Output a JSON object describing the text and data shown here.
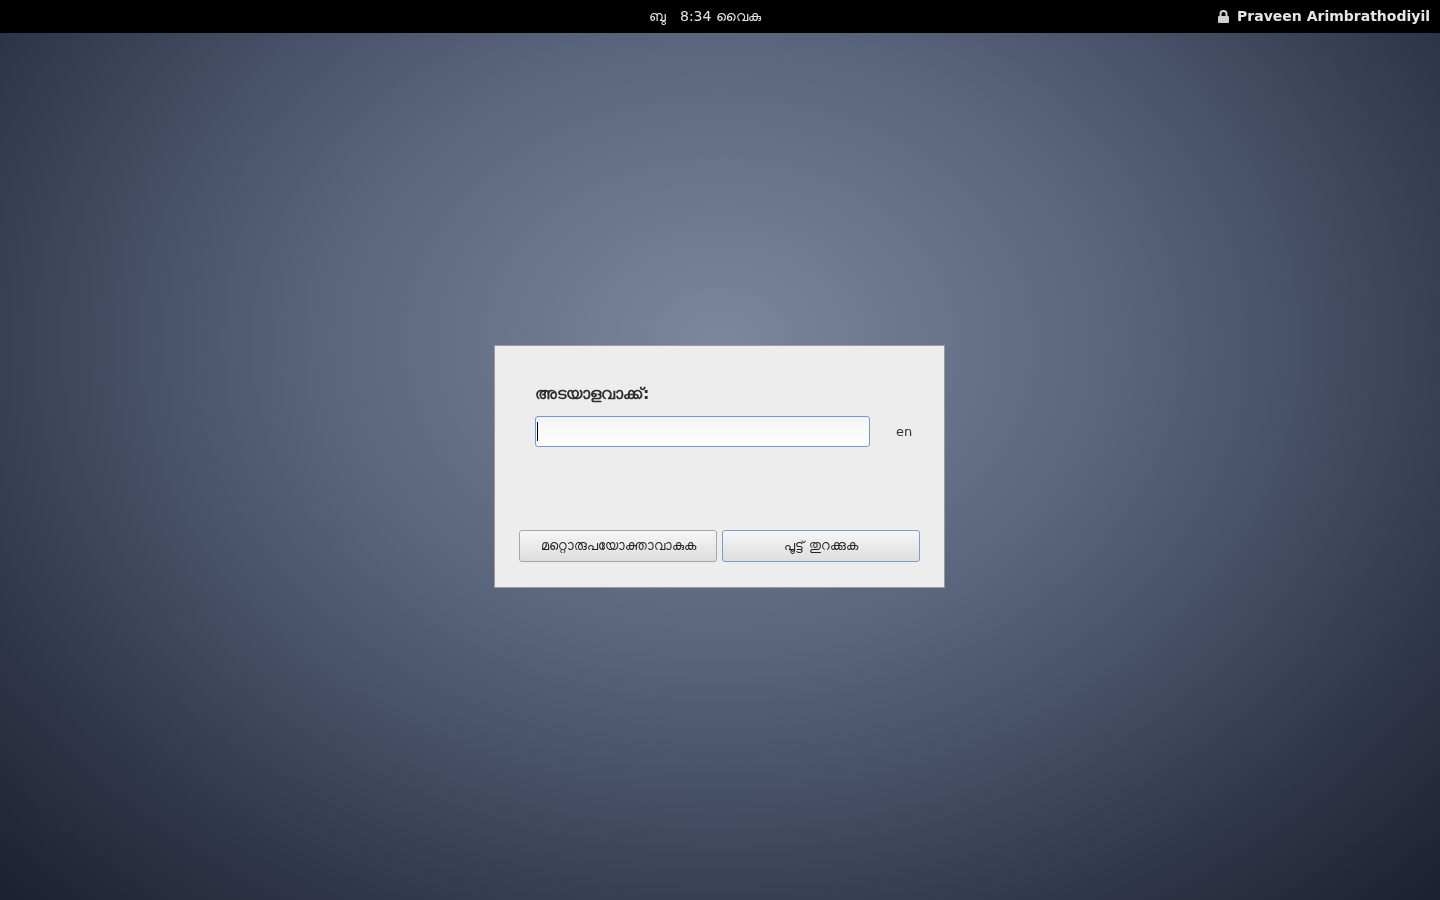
{
  "top_bar": {
    "day": "ബു",
    "time": "8:34 വൈകു",
    "user": "Praveen Arimbrathodiyil"
  },
  "dialog": {
    "prompt": "അടയാളവാക്ക്:",
    "password_field": {
      "focused": true
    },
    "keyboard_layout": "en",
    "buttons": [
      {
        "label": "മറ്റൊരുപയോക്താവാകുക",
        "default": false
      },
      {
        "label": "പൂട്ട് തുറക്കുക",
        "default": true
      }
    ]
  }
}
